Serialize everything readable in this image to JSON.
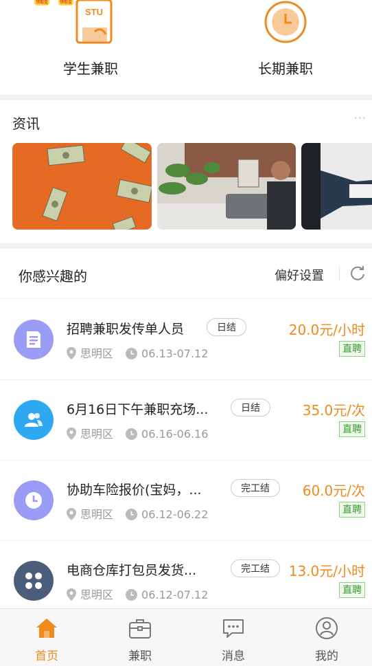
{
  "categories": [
    {
      "label": "学生兼职",
      "icon": "student-book-icon",
      "icon_text": "STU"
    },
    {
      "label": "长期兼职",
      "icon": "clock-icon"
    }
  ],
  "top_badges": [
    "领现金",
    "领现金"
  ],
  "news": {
    "title": "资讯",
    "more": "···",
    "cards": [
      {
        "icon": "money-falling-image"
      },
      {
        "icon": "man-on-phone-image"
      },
      {
        "icon": "handshake-image"
      }
    ]
  },
  "interest": {
    "title": "你感兴趣的",
    "pref_label": "偏好设置",
    "refresh_icon": "refresh-icon"
  },
  "jobs": [
    {
      "title": "招聘兼职发传单人员",
      "tag": "日结",
      "price": "20.0元/小时",
      "badge": "直聘",
      "location": "思明区",
      "date": "06.13-07.12",
      "avatar_color": "#9b9cf5",
      "avatar_icon": "document-icon"
    },
    {
      "title": "6月16日下午兼职充场...",
      "tag": "日结",
      "price": "35.0元/次",
      "badge": "直聘",
      "location": "思明区",
      "date": "06.16-06.16",
      "avatar_color": "#2fa8f2",
      "avatar_icon": "people-icon"
    },
    {
      "title": "协助车险报价(宝妈，...",
      "tag": "完工结",
      "price": "60.0元/次",
      "badge": "直聘",
      "location": "思明区",
      "date": "06.12-06.22",
      "avatar_color": "#9b9cf5",
      "avatar_icon": "clock-icon"
    },
    {
      "title": "电商仓库打包员发货...",
      "tag": "完工结",
      "price": "13.0元/小时",
      "badge": "直聘",
      "location": "思明区",
      "date": "06.12-07.12",
      "avatar_color": "#4a5e7a",
      "avatar_icon": "grid-icon"
    }
  ],
  "tabs": [
    {
      "label": "首页",
      "icon": "home-icon",
      "active": true
    },
    {
      "label": "兼职",
      "icon": "briefcase-icon",
      "active": false
    },
    {
      "label": "消息",
      "icon": "chat-bubble-icon",
      "active": false
    },
    {
      "label": "我的",
      "icon": "user-profile-icon",
      "active": false
    }
  ],
  "colors": {
    "accent": "#f08a1c",
    "direct_badge": "#3a9a2e"
  }
}
